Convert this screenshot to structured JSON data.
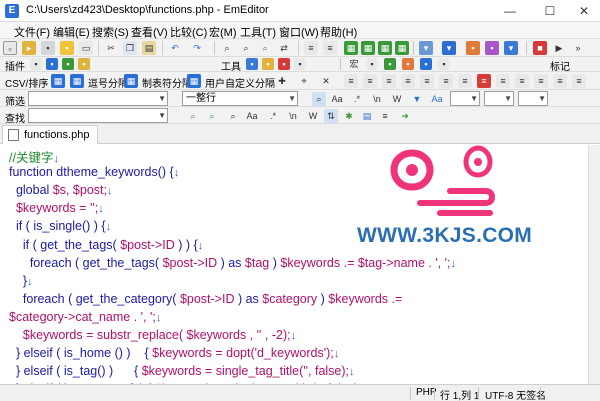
{
  "window": {
    "title": "C:\\Users\\zd423\\Desktop\\functions.php - EmEditor",
    "app_icon": "E",
    "minimize": "—",
    "maximize": "☐",
    "close": "✕"
  },
  "menu": [
    "文件(F)",
    "编辑(E)",
    "搜索(S)",
    "查看(V)",
    "比较(C)",
    "宏(M)",
    "工具(T)",
    "窗口(W)",
    "帮助(H)"
  ],
  "toolbars": {
    "plugins_label": "插件",
    "tools_label": "工具",
    "markers_label": "标记",
    "csv_label": "CSV/排序",
    "csv_buttons": [
      "逗号分隔",
      "制表符分隔",
      "用户自定义分隔"
    ],
    "filter_label": "筛选",
    "filter_scope": "一整行",
    "search_label": "查找"
  },
  "tabs": [
    {
      "label": "functions.php"
    }
  ],
  "code_lines": [
    {
      "parts": [
        {
          "t": "//关键字",
          "c": "cm"
        },
        {
          "t": "↓",
          "c": "nl"
        }
      ]
    },
    {
      "parts": [
        {
          "t": "function ",
          "c": "kw"
        },
        {
          "t": "dtheme_keywords",
          "c": "kw"
        },
        {
          "t": "() {",
          "c": "kw"
        },
        {
          "t": "↓",
          "c": "nl"
        }
      ]
    },
    {
      "parts": [
        {
          "t": "  global ",
          "c": "kw"
        },
        {
          "t": "$s, $post;",
          "c": ""
        },
        {
          "t": "↓",
          "c": "nl"
        }
      ]
    },
    {
      "parts": [
        {
          "t": "  $keywords = '';",
          "c": ""
        },
        {
          "t": "↓",
          "c": "nl"
        }
      ]
    },
    {
      "parts": [
        {
          "t": "  if ",
          "c": "kw"
        },
        {
          "t": "( ",
          "c": "kw"
        },
        {
          "t": "is_single",
          "c": "kw"
        },
        {
          "t": "() ) {",
          "c": "kw"
        },
        {
          "t": "↓",
          "c": "nl"
        }
      ]
    },
    {
      "parts": [
        {
          "t": "    if ",
          "c": "kw"
        },
        {
          "t": "( get_the_tags( ",
          "c": "kw"
        },
        {
          "t": "$post->ID",
          "c": ""
        },
        {
          "t": " ) ) {",
          "c": "kw"
        },
        {
          "t": "↓",
          "c": "nl"
        }
      ]
    },
    {
      "parts": [
        {
          "t": "      foreach ",
          "c": "kw"
        },
        {
          "t": "( get_the_tags( ",
          "c": "kw"
        },
        {
          "t": "$post->ID",
          "c": ""
        },
        {
          "t": " ) as ",
          "c": "kw"
        },
        {
          "t": "$tag",
          "c": ""
        },
        {
          "t": " ) ",
          "c": "kw"
        },
        {
          "t": "$keywords .= $tag->name . ', ';",
          "c": ""
        },
        {
          "t": "↓",
          "c": "nl"
        }
      ]
    },
    {
      "parts": [
        {
          "t": "    }",
          "c": "kw"
        },
        {
          "t": "↓",
          "c": "nl"
        }
      ]
    },
    {
      "parts": [
        {
          "t": "    foreach ",
          "c": "kw"
        },
        {
          "t": "( get_the_category( ",
          "c": "kw"
        },
        {
          "t": "$post->ID",
          "c": ""
        },
        {
          "t": " ) as ",
          "c": "kw"
        },
        {
          "t": "$category",
          "c": ""
        },
        {
          "t": " ) ",
          "c": "kw"
        },
        {
          "t": "$keywords .=",
          "c": ""
        }
      ]
    },
    {
      "parts": [
        {
          "t": "$category->cat_name . ', ';",
          "c": ""
        },
        {
          "t": "↓",
          "c": "nl"
        }
      ]
    },
    {
      "parts": [
        {
          "t": "    $keywords = substr_replace( $keywords , '' , -2);",
          "c": ""
        },
        {
          "t": "↓",
          "c": "nl"
        }
      ]
    },
    {
      "parts": [
        {
          "t": "  } ",
          "c": "kw"
        },
        {
          "t": "elseif ",
          "c": "kw"
        },
        {
          "t": "( ",
          "c": "kw"
        },
        {
          "t": "is_home",
          "c": "kw"
        },
        {
          "t": " () )    { ",
          "c": "kw"
        },
        {
          "t": "$keywords = dopt('d_keywords');",
          "c": ""
        },
        {
          "t": "↓",
          "c": "nl"
        }
      ]
    },
    {
      "parts": [
        {
          "t": "  } ",
          "c": "kw"
        },
        {
          "t": "elseif ",
          "c": "kw"
        },
        {
          "t": "( ",
          "c": "kw"
        },
        {
          "t": "is_tag",
          "c": "kw"
        },
        {
          "t": "() )      { ",
          "c": "kw"
        },
        {
          "t": "$keywords = single_tag_title('', false);",
          "c": ""
        },
        {
          "t": "↓",
          "c": "nl"
        }
      ]
    },
    {
      "parts": [
        {
          "t": "  } ",
          "c": "kw"
        },
        {
          "t": "elseif ",
          "c": "kw"
        },
        {
          "t": "( ",
          "c": "kw"
        },
        {
          "t": "is_category",
          "c": "kw"
        },
        {
          "t": "() ) { ",
          "c": "kw"
        },
        {
          "t": "$keywords = single_cat_title('', false);",
          "c": ""
        },
        {
          "t": "↓",
          "c": "nl"
        }
      ]
    }
  ],
  "watermark": {
    "text": "WWW.3KJS.COM",
    "color_pink": "#f0347c",
    "color_blue": "#2a6fb6"
  },
  "status": {
    "language": "PHP",
    "position": "行 1,列 1",
    "encoding": "UTF-8 无签名"
  },
  "colors": {
    "keyword": "#1a1aa6",
    "variable": "#b0106c",
    "comment": "#1b8a2e"
  }
}
